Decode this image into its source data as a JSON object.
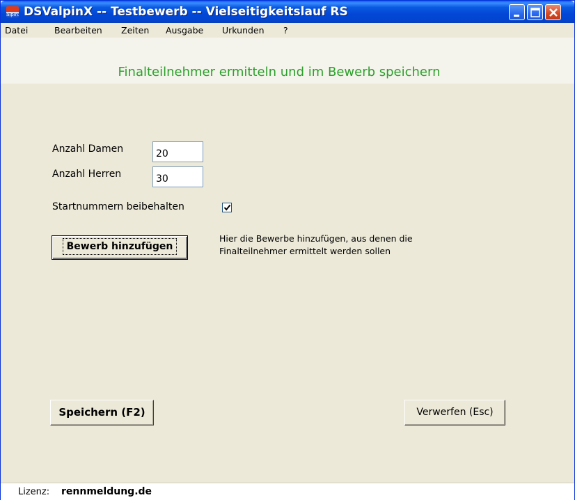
{
  "window": {
    "title": "DSValpinX -- Testbewerb -- Vielseitigkeitslauf RS",
    "icon_text": "alpinx"
  },
  "menu": [
    "Datei",
    "Bearbeiten",
    "Zeiten",
    "Ausgabe",
    "Urkunden",
    "?"
  ],
  "header": {
    "title": "Finalteilnehmer ermitteln und im Bewerb speichern",
    "title_color": "#2aa02a"
  },
  "form": {
    "damen_label": "Anzahl Damen",
    "damen_value": "20",
    "herren_label": "Anzahl Herren",
    "herren_value": "30",
    "startnummern_label": "Startnummern beibehalten",
    "startnummern_checked": true
  },
  "buttons": {
    "add_competition": "Bewerb hinzufügen",
    "save": "Speichern (F2)",
    "discard": "Verwerfen (Esc)"
  },
  "hint": {
    "line1": "Hier die Bewerbe hinzufügen, aus denen die",
    "line2": "Finalteilnehmer ermittelt werden sollen"
  },
  "status": {
    "label": "Lizenz:",
    "value": "rennmeldung.de"
  },
  "icons": {
    "app": "app-icon",
    "minimize": "minimize-icon",
    "maximize": "maximize-icon",
    "close": "close-icon",
    "check": "checkmark-icon"
  }
}
